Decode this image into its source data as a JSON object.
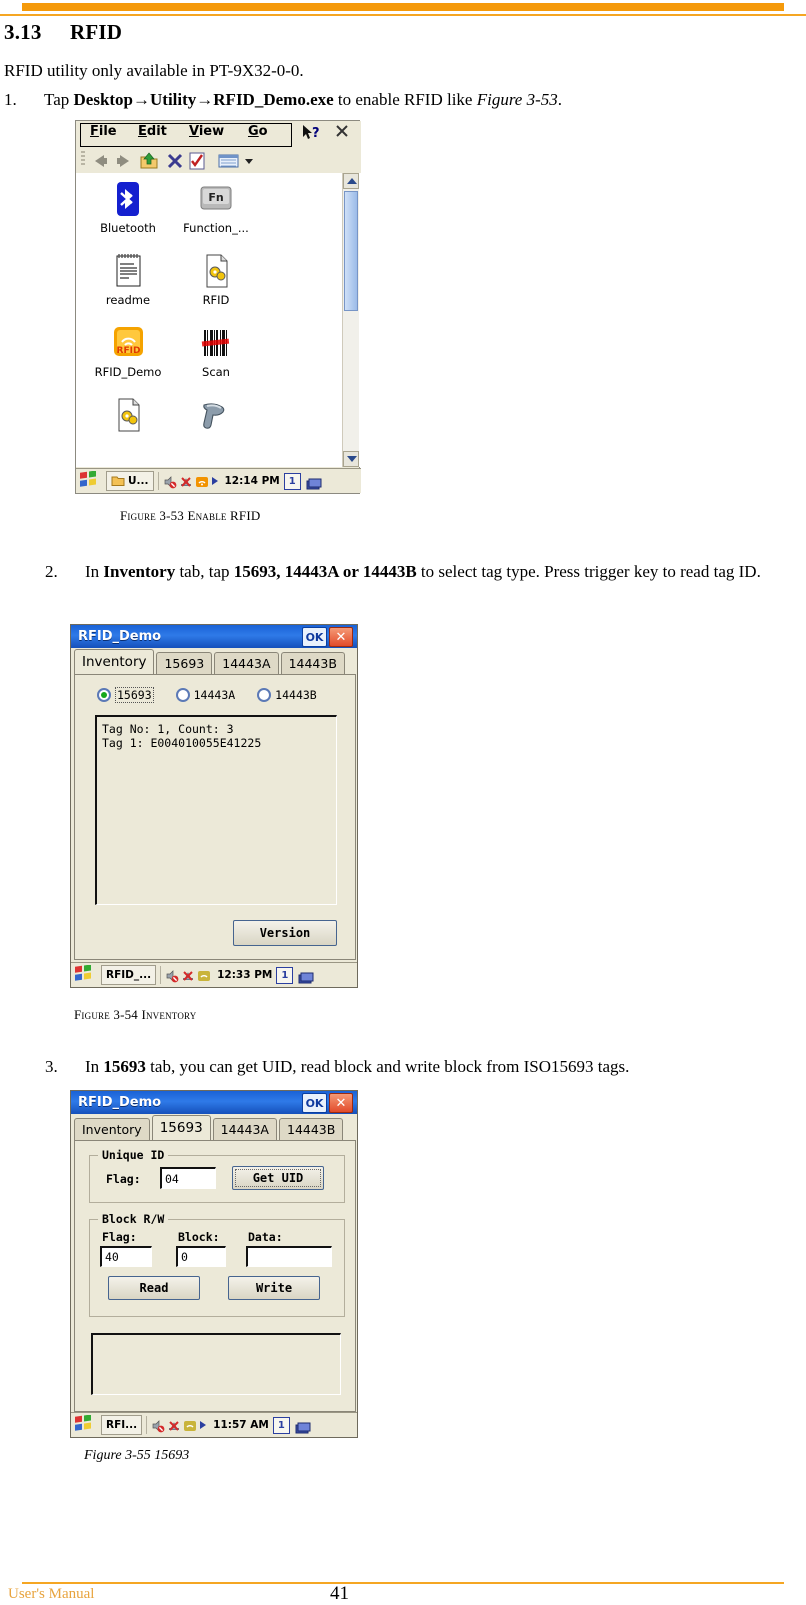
{
  "header": {
    "rule": true
  },
  "section": {
    "number": "3.13",
    "title": "RFID"
  },
  "intro": "RFID utility only available in PT-9X32-0-0.",
  "steps": [
    {
      "index": "1.",
      "parts": [
        {
          "t": "Tap ",
          "s": "n"
        },
        {
          "t": "Desktop→Utility→RFID_Demo.exe",
          "s": "b"
        },
        {
          "t": " to enable RFID like ",
          "s": "n"
        },
        {
          "t": "Figure 3-53",
          "s": "i"
        },
        {
          "t": ".",
          "s": "n"
        }
      ]
    },
    {
      "index": "2.",
      "parts": [
        {
          "t": "In ",
          "s": "n"
        },
        {
          "t": "Inventory",
          "s": "b"
        },
        {
          "t": " tab, tap ",
          "s": "n"
        },
        {
          "t": "15693, 14443A or 14443B",
          "s": "b"
        },
        {
          "t": " to select tag type. Press trigger key to read tag ID.",
          "s": "n"
        }
      ]
    },
    {
      "index": "3.",
      "parts": [
        {
          "t": "In ",
          "s": "n"
        },
        {
          "t": "15693",
          "s": "b"
        },
        {
          "t": " tab, you can get UID, read block and write block from ISO15693 tags.",
          "s": "n"
        }
      ]
    }
  ],
  "captions": {
    "fig53": "Figure 3-53 Enable RFID",
    "fig54": "Figure 3-54 Inventory",
    "fig55": "Figure 3-55 15693"
  },
  "explorer": {
    "menu": [
      {
        "label": "File",
        "accel": "F"
      },
      {
        "label": "Edit",
        "accel": "E"
      },
      {
        "label": "View",
        "accel": "V"
      },
      {
        "label": "Go",
        "accel": "G"
      }
    ],
    "help_icon": "help-arrow-icon",
    "close_icon": "close-icon",
    "toolbar_icons": [
      "back-icon",
      "forward-icon",
      "up-folder-icon",
      "delete-icon",
      "properties-icon",
      "view-mode-icon",
      "view-dropdown-icon"
    ],
    "icons": [
      {
        "name": "Bluetooth",
        "icon": "bluetooth-icon"
      },
      {
        "name": "Function_...",
        "icon": "function-key-icon"
      },
      {
        "name": "readme",
        "icon": "notepad-icon"
      },
      {
        "name": "RFID",
        "icon": "config-file-icon"
      },
      {
        "name": "RFID_Demo",
        "icon": "rfid-app-icon"
      },
      {
        "name": "Scan",
        "icon": "barcode-icon"
      },
      {
        "name": "",
        "icon": "config-file-icon"
      },
      {
        "name": "",
        "icon": "scanner-gun-icon"
      }
    ],
    "taskbar": {
      "app": "U...",
      "time": "12:14 PM",
      "count": "1"
    }
  },
  "dialog_inventory": {
    "title": "RFID_Demo",
    "ok_label": "OK",
    "close_label": "✕",
    "tabs": [
      {
        "label": "Inventory",
        "selected": true
      },
      {
        "label": "15693",
        "selected": false
      },
      {
        "label": "14443A",
        "selected": false
      },
      {
        "label": "14443B",
        "selected": false
      }
    ],
    "radios": [
      {
        "label": "15693",
        "checked": true
      },
      {
        "label": "14443A",
        "checked": false
      },
      {
        "label": "14443B",
        "checked": false
      }
    ],
    "log_lines": [
      "Tag No: 1, Count: 3",
      "Tag 1: E004010055E41225"
    ],
    "version_button": "Version",
    "taskbar": {
      "app": "RFID_...",
      "time": "12:33 PM",
      "count": "1"
    }
  },
  "dialog_15693": {
    "title": "RFID_Demo",
    "ok_label": "OK",
    "close_label": "✕",
    "tabs": [
      {
        "label": "Inventory",
        "selected": false
      },
      {
        "label": "15693",
        "selected": true
      },
      {
        "label": "14443A",
        "selected": false
      },
      {
        "label": "14443B",
        "selected": false
      }
    ],
    "unique_id": {
      "group": "Unique ID",
      "flag_label": "Flag:",
      "flag_value": "04",
      "button": "Get UID"
    },
    "block_rw": {
      "group": "Block R/W",
      "flag_label": "Flag:",
      "flag_value": "40",
      "block_label": "Block:",
      "block_value": "0",
      "data_label": "Data:",
      "data_value": "",
      "read_button": "Read",
      "write_button": "Write"
    },
    "log_lines": [],
    "taskbar": {
      "app": "RFI...",
      "time": "11:57 AM",
      "count": "1"
    }
  },
  "footer": {
    "left": "User's Manual",
    "page": "41"
  }
}
